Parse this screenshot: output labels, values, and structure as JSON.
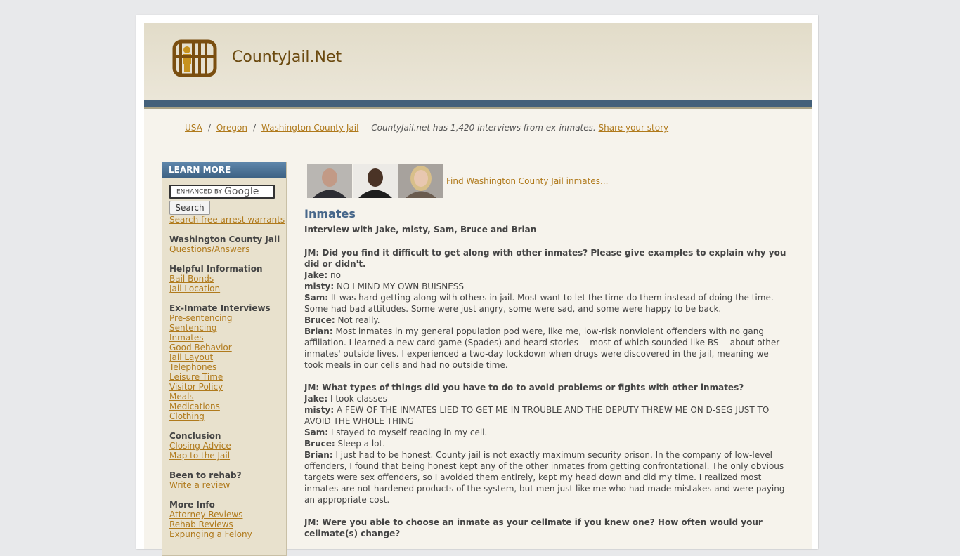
{
  "header": {
    "site_title": "CountyJail.Net"
  },
  "breadcrumb": {
    "items": [
      "USA",
      "Oregon",
      "Washington County Jail"
    ],
    "note": "CountyJail.net has 1,420 interviews from ex-inmates.",
    "share_link": "Share your story"
  },
  "sidebar": {
    "heading": "LEARN MORE",
    "search": {
      "google_label": "ENHANCED BY",
      "google_brand": "Google",
      "button": "Search"
    },
    "arrest_link": "Search free arrest warrants",
    "sections": [
      {
        "title": "Washington County Jail",
        "links": [
          "Questions/Answers"
        ]
      },
      {
        "title": "Helpful Information",
        "links": [
          "Bail Bonds",
          "Jail Location"
        ]
      },
      {
        "title": "Ex-Inmate Interviews",
        "links": [
          "Pre-sentencing",
          "Sentencing",
          "Inmates",
          "Good Behavior",
          "Jail Layout",
          "Telephones",
          "Leisure Time",
          "Visitor Policy",
          "Meals",
          "Medications",
          "Clothing"
        ]
      },
      {
        "title": "Conclusion",
        "links": [
          "Closing Advice",
          "Map to the Jail"
        ]
      },
      {
        "title": "Been to rehab?",
        "links": [
          "Write a review"
        ]
      },
      {
        "title": "More Info",
        "links": [
          "Attorney Reviews",
          "Rehab Reviews",
          "Expunging a Felony"
        ]
      }
    ]
  },
  "main": {
    "find_link": "Find Washington County Jail inmates...",
    "title": "Inmates",
    "interview_line": "Interview with Jake, misty, Sam, Bruce and Brian",
    "qa": [
      {
        "question": "JM: Did you find it difficult to get along with other inmates? Please give examples to explain why you did or didn't.",
        "answers": [
          {
            "name": "Jake:",
            "text": "no"
          },
          {
            "name": "misty:",
            "text": "NO I MIND MY OWN BUISNESS"
          },
          {
            "name": "Sam:",
            "text": "It was hard getting along with others in jail. Most want to let the time do them instead of doing the time. Some had bad attitudes. Some were just angry, some were sad, and some were happy to be back."
          },
          {
            "name": "Bruce:",
            "text": "Not really."
          },
          {
            "name": "Brian:",
            "text": "Most inmates in my general population pod were, like me, low-risk nonviolent offenders with no gang affiliation. I learned a new card game (Spades) and heard stories -- most of which sounded like BS -- about other inmates' outside lives. I experienced a two-day lockdown when drugs were discovered in the jail, meaning we took meals in our cells and had no outside time."
          }
        ]
      },
      {
        "question": "JM: What types of things did you have to do to avoid problems or fights with other inmates?",
        "answers": [
          {
            "name": "Jake:",
            "text": "I took classes"
          },
          {
            "name": "misty:",
            "text": "A FEW OF THE INMATES LIED TO GET ME IN TROUBLE AND THE DEPUTY THREW ME ON D-SEG JUST TO AVOID THE WHOLE THING"
          },
          {
            "name": "Sam:",
            "text": "I stayed to myself reading in my cell."
          },
          {
            "name": "Bruce:",
            "text": "Sleep a lot."
          },
          {
            "name": "Brian:",
            "text": "I just had to be honest. County jail is not exactly maximum security prison. In the company of low-level offenders, I found that being honest kept any of the other inmates from getting confrontational. The only obvious targets were sex offenders, so I avoided them entirely, kept my head down and did my time. I realized most inmates are not hardened products of the system, but men just like me who had made mistakes and were paying an appropriate cost."
          }
        ]
      },
      {
        "question": "JM: Were you able to choose an inmate as your cellmate if you knew one? How often would your cellmate(s) change?",
        "answers": []
      }
    ]
  },
  "colors": {
    "accent": "#b07a1c",
    "header_bar": "#44607a",
    "title_blue": "#47678a",
    "sidebar_bg": "#e8e1cd"
  },
  "icons": {
    "logo": "jail-cell-icon"
  }
}
